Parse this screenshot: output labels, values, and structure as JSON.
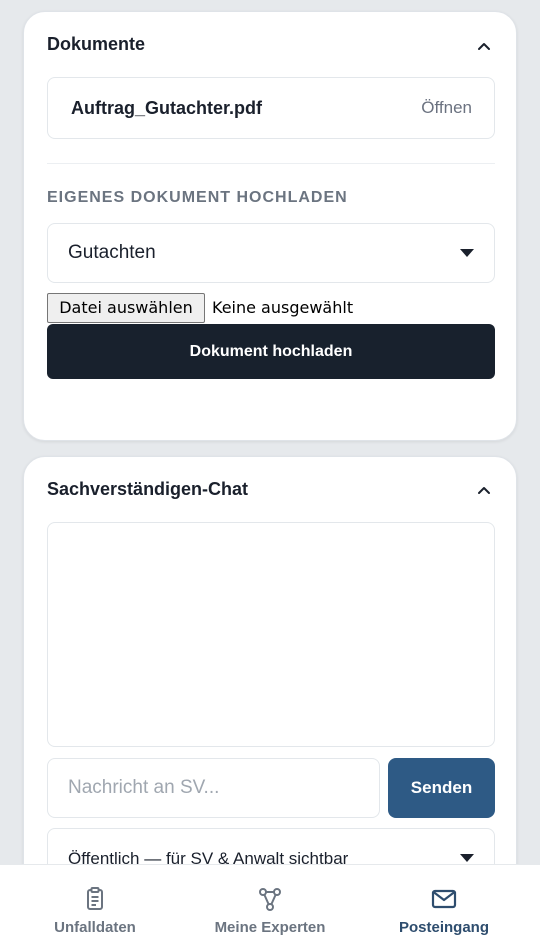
{
  "documents_card": {
    "title": "Dokumente",
    "file": {
      "name": "Auftrag_Gutachter.pdf",
      "action": "Öffnen"
    },
    "upload_section_label": "EIGENES DOKUMENT HOCHLADEN",
    "doc_type_select": {
      "selected": "Gutachten"
    },
    "file_input": {
      "button_label": "Datei auswählen",
      "status": "Keine ausgewählt"
    },
    "upload_button": "Dokument hochladen"
  },
  "chat_card": {
    "title": "Sachverständigen-Chat",
    "message_input": {
      "placeholder": "Nachricht an SV..."
    },
    "send_button": "Senden",
    "visibility_select": {
      "selected": "Öffentlich — für SV & Anwalt sichtbar"
    }
  },
  "bottom_nav": {
    "items": [
      {
        "label": "Unfalldaten",
        "icon": "clipboard-icon",
        "active": false
      },
      {
        "label": "Meine Experten",
        "icon": "network-icon",
        "active": false
      },
      {
        "label": "Posteingang",
        "icon": "mail-icon",
        "active": true
      }
    ]
  },
  "colors": {
    "background": "#e6e9ec",
    "primary_dark": "#18212d",
    "accent_blue": "#2e5a85",
    "muted_text": "#6b7480"
  }
}
